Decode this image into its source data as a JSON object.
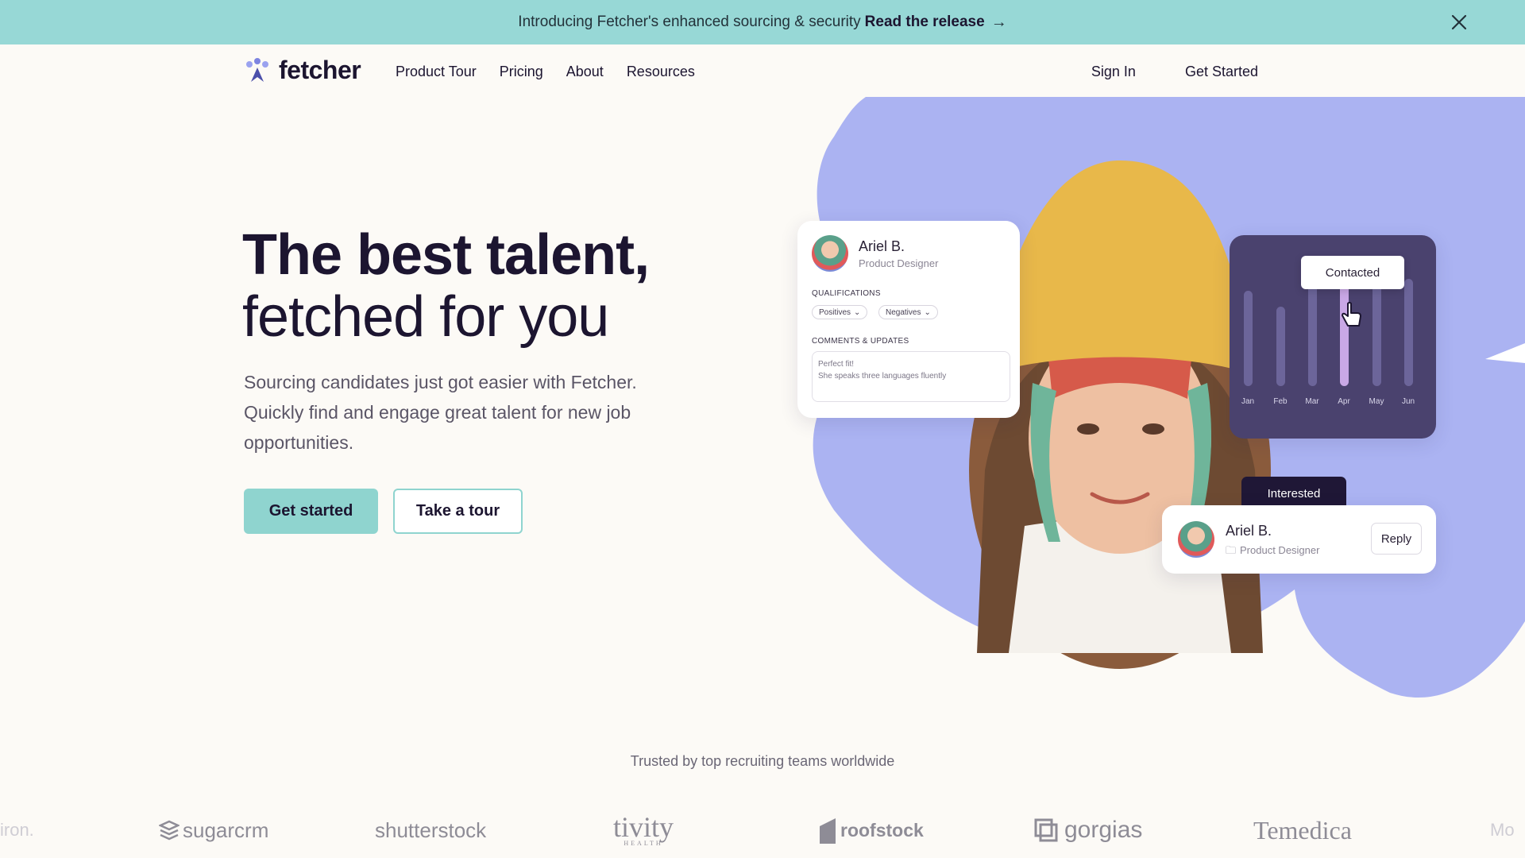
{
  "announcement": {
    "text": "Introducing Fetcher's enhanced sourcing & security",
    "link": "Read the release",
    "arrow": "→",
    "close_icon": "close-icon"
  },
  "nav": {
    "brand": "fetcher",
    "links": [
      "Product Tour",
      "Pricing",
      "About",
      "Resources"
    ],
    "sign_in": "Sign In",
    "get_started": "Get Started"
  },
  "hero": {
    "title_line1": "The best talent,",
    "title_line2": "fetched for you",
    "subtitle": "Sourcing candidates just got easier with Fetcher. Quickly find and engage great talent for new job opportunities.",
    "cta_primary": "Get started",
    "cta_secondary": "Take a tour"
  },
  "profile_card": {
    "name": "Ariel B.",
    "role": "Product Designer",
    "qualifications_label": "QUALIFICATIONS",
    "positives": "Positives",
    "negatives": "Negatives",
    "comments_label": "COMMENTS & UPDATES",
    "comment_line1": "Perfect fit!",
    "comment_line2": "She speaks three languages fluently"
  },
  "chart_card": {
    "tooltip": "Contacted",
    "months": [
      "Jan",
      "Feb",
      "Mar",
      "Apr",
      "May",
      "Jun"
    ],
    "highlight_month": "Apr"
  },
  "reply_card": {
    "status": "Interested",
    "name": "Ariel B.",
    "role": "Product Designer",
    "reply": "Reply"
  },
  "trusted": {
    "heading": "Trusted by top recruiting teams worldwide",
    "logos": [
      "sugarcrm",
      "shutterstock",
      "tivity",
      "roofstock",
      "gorgias",
      "Temedica"
    ],
    "tivity_sub": "HEALTH",
    "partial_left": "iron.",
    "partial_right": "Mo"
  },
  "colors": {
    "announce_bg": "#97d8d6",
    "accent": "#8fd4cf",
    "blob": "#abb3f2",
    "dark": "#1c1530"
  }
}
